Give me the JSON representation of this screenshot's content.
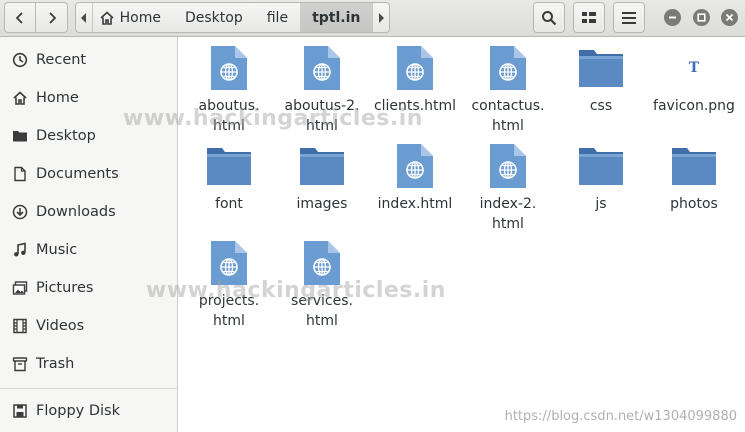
{
  "header": {
    "back_icon": "chevron-left-icon",
    "forward_icon": "chevron-right-icon",
    "path": {
      "left_arrow_icon": "chevron-left-icon",
      "right_arrow_icon": "chevron-right-icon",
      "crumbs": [
        {
          "label": "Home",
          "icon": "home-icon"
        },
        {
          "label": "Desktop"
        },
        {
          "label": "file"
        },
        {
          "label": "tptl.in",
          "active": true
        }
      ]
    },
    "search_icon": "search-icon",
    "view_icon": "view-options-icon",
    "menu_icon": "hamburger-menu-icon"
  },
  "sidebar": {
    "items": [
      {
        "label": "Recent",
        "icon": "clock-icon"
      },
      {
        "label": "Home",
        "icon": "home-icon"
      },
      {
        "label": "Desktop",
        "icon": "folder-icon"
      },
      {
        "label": "Documents",
        "icon": "document-icon"
      },
      {
        "label": "Downloads",
        "icon": "download-icon"
      },
      {
        "label": "Music",
        "icon": "music-note-icon"
      },
      {
        "label": "Pictures",
        "icon": "picture-icon"
      },
      {
        "label": "Videos",
        "icon": "film-icon"
      },
      {
        "label": "Trash",
        "icon": "trash-icon"
      },
      {
        "label": "Floppy Disk",
        "icon": "floppy-disk-icon"
      }
    ]
  },
  "files": [
    {
      "label": "aboutus.\nhtml",
      "type": "html"
    },
    {
      "label": "aboutus-2.\nhtml",
      "type": "html"
    },
    {
      "label": "clients.html",
      "type": "html"
    },
    {
      "label": "contactus.\nhtml",
      "type": "html"
    },
    {
      "label": "css",
      "type": "folder"
    },
    {
      "label": "favicon.png",
      "type": "image"
    },
    {
      "label": "font",
      "type": "folder"
    },
    {
      "label": "images",
      "type": "folder"
    },
    {
      "label": "index.html",
      "type": "html"
    },
    {
      "label": "index-2.\nhtml",
      "type": "html"
    },
    {
      "label": "js",
      "type": "folder"
    },
    {
      "label": "photos",
      "type": "folder"
    },
    {
      "label": "projects.\nhtml",
      "type": "html"
    },
    {
      "label": "services.\nhtml",
      "type": "html"
    }
  ],
  "favicon_glyph": "T",
  "watermarks": {
    "main": "www.hackingarticles.in",
    "corner": "https://blog.csdn.net/w1304099880"
  },
  "colors": {
    "folder": "#5b8ac2",
    "html_doc": "#6a9bd1",
    "icon_gray": "#3b3b3b"
  }
}
